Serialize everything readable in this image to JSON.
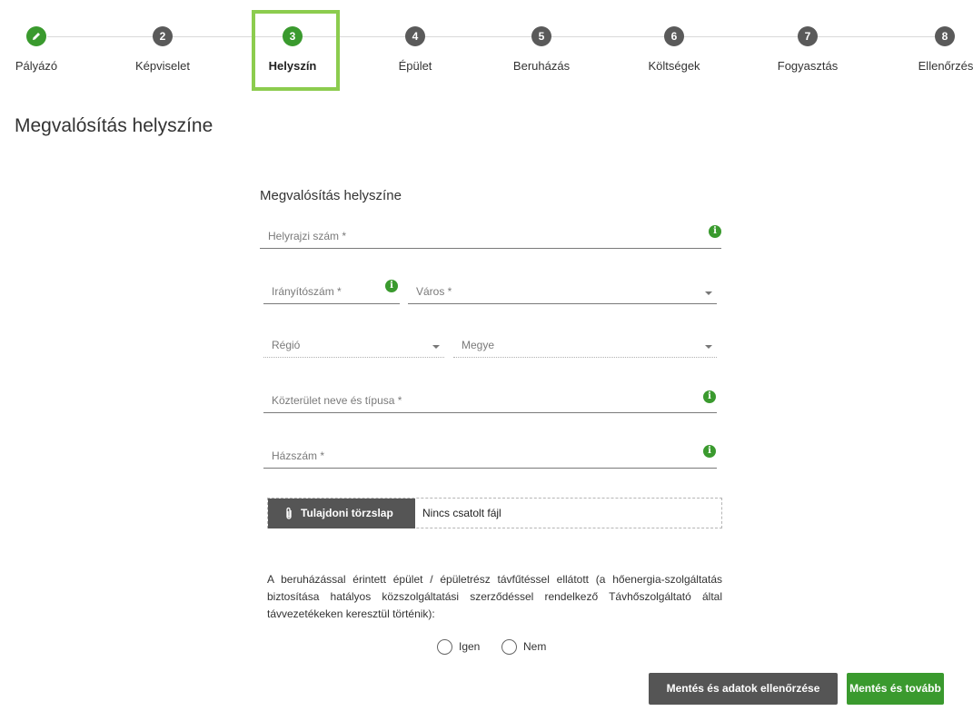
{
  "steps": [
    {
      "number": "",
      "label": "Pályázó",
      "state": "done",
      "icon": "pencil-icon"
    },
    {
      "number": "2",
      "label": "Képviselet",
      "state": "todo"
    },
    {
      "number": "3",
      "label": "Helyszín",
      "state": "active"
    },
    {
      "number": "4",
      "label": "Épület",
      "state": "todo"
    },
    {
      "number": "5",
      "label": "Beruházás",
      "state": "todo"
    },
    {
      "number": "6",
      "label": "Költségek",
      "state": "todo"
    },
    {
      "number": "7",
      "label": "Fogyasztás",
      "state": "todo"
    },
    {
      "number": "8",
      "label": "Ellenőrzés",
      "state": "todo"
    }
  ],
  "page_title": "Megvalósítás helyszíne",
  "form": {
    "section_title": "Megvalósítás helyszíne",
    "helyrajzi": {
      "placeholder": "Helyrajzi szám *",
      "value": ""
    },
    "iranyitoszam": {
      "placeholder": "Irányítószám *",
      "value": ""
    },
    "varos": {
      "placeholder": "Város *",
      "value": ""
    },
    "regio": {
      "placeholder": "Régió",
      "value": ""
    },
    "megye": {
      "placeholder": "Megye",
      "value": ""
    },
    "kozterulet": {
      "placeholder": "Közterület neve és típusa *",
      "value": ""
    },
    "hazszam": {
      "placeholder": "Házszám *",
      "value": ""
    },
    "info_glyph": "i"
  },
  "attachment": {
    "button_label": "Tulajdoni törzslap",
    "status": "Nincs csatolt fájl",
    "icon": "paperclip-icon"
  },
  "question": {
    "text": "A beruházással érintett épület / épületrész távfűtéssel ellátott (a hőenergia-szolgáltatás biztosítása hatályos közszolgáltatási szerződéssel rendelkező Távhőszolgáltató által távvezetékeken keresztül történik):",
    "options": [
      "Igen",
      "Nem"
    ],
    "selected": null
  },
  "buttons": {
    "check": "Mentés és adatok ellenőrzése",
    "next": "Mentés és tovább"
  },
  "colors": {
    "accent_green": "#3a9a2e",
    "active_box": "#8ccc4e",
    "dark_gray": "#555555"
  }
}
